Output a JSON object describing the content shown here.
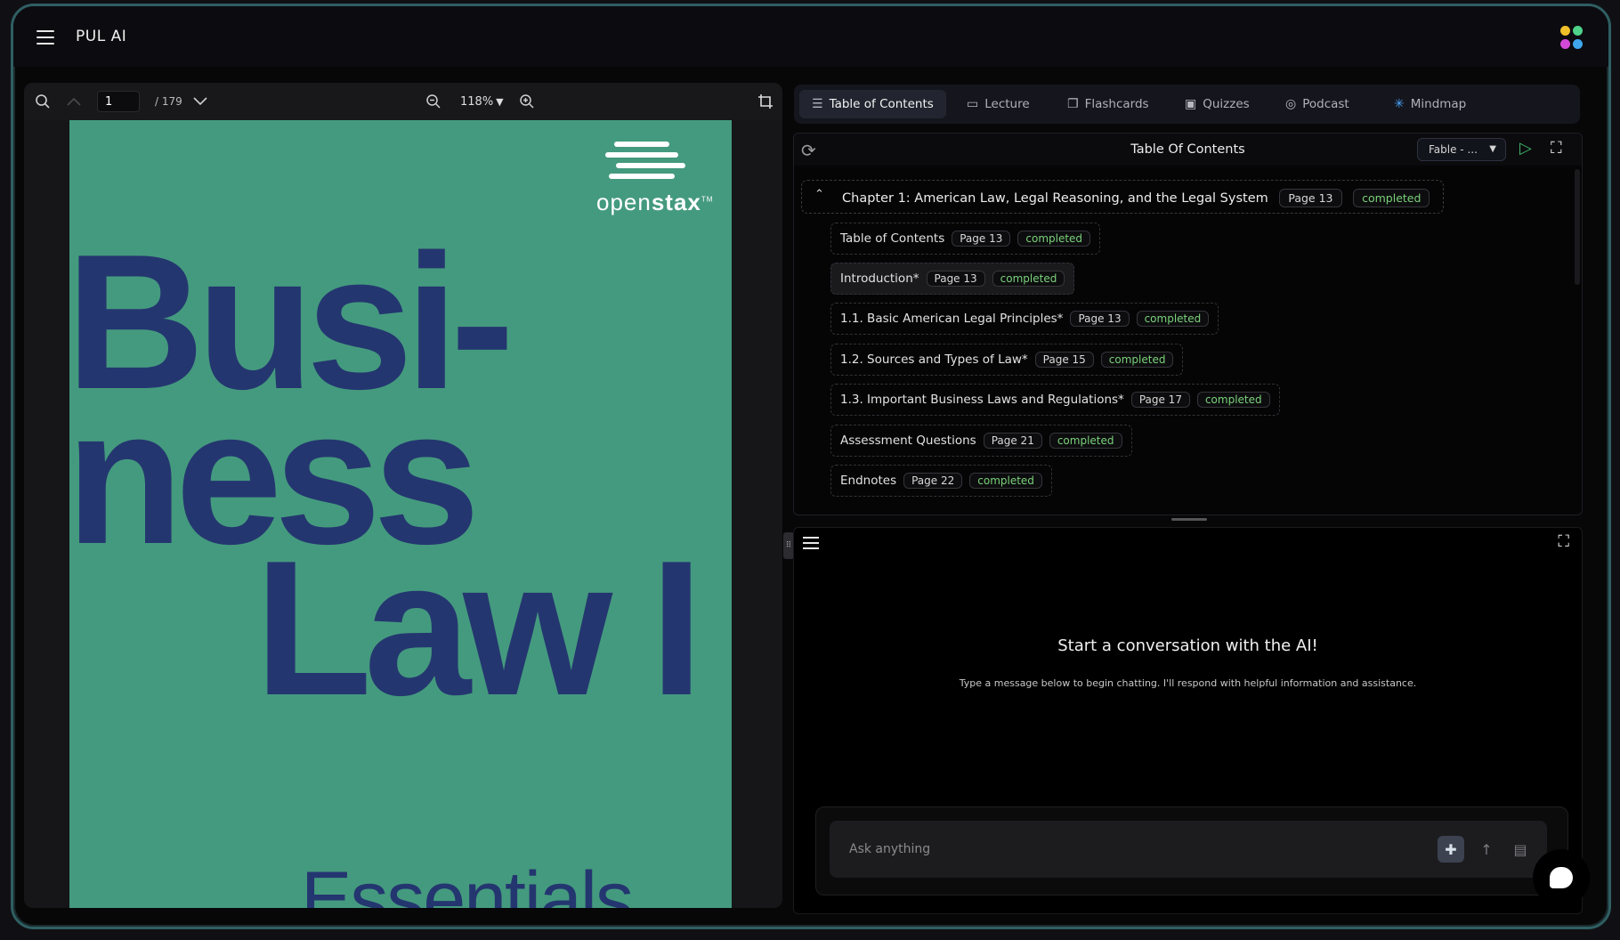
{
  "app": {
    "title": "PUL AI"
  },
  "colors": {
    "accent": "#449a7e",
    "cover_title": "#243670",
    "completed": "#7ad27a",
    "play": "#3fb56a",
    "frame": "#2f5f63"
  },
  "pdf_toolbar": {
    "page_value": "1",
    "page_total": "/ 179",
    "zoom": "118%",
    "icons": [
      "search-icon",
      "chevron-up-icon",
      "chevron-down-icon",
      "zoom-out-icon",
      "zoom-in-icon",
      "crop-icon"
    ]
  },
  "cover": {
    "logo_text_light": "open",
    "logo_text_bold": "stax",
    "logo_tm": "TM",
    "line1": "Busi-",
    "line2": "ness",
    "line3": "Law I",
    "line4": "Essentials"
  },
  "tabs": [
    {
      "label": "Table of Contents",
      "icon": "list-icon"
    },
    {
      "label": "Lecture",
      "icon": "presentation-icon"
    },
    {
      "label": "Flashcards",
      "icon": "cards-icon"
    },
    {
      "label": "Quizzes",
      "icon": "quiz-icon"
    },
    {
      "label": "Podcast",
      "icon": "podcast-icon"
    },
    {
      "label": "Mindmap",
      "icon": "mindmap-icon"
    }
  ],
  "toc": {
    "title": "Table Of Contents",
    "voice_select": "Fable - ...",
    "chapter": {
      "label": "Chapter 1: American Law, Legal Reasoning, and the Legal System",
      "page": "Page 13",
      "status": "completed"
    },
    "items": [
      {
        "label": "Table of Contents",
        "page": "Page 13",
        "status": "completed"
      },
      {
        "label": "Introduction*",
        "page": "Page 13",
        "status": "completed"
      },
      {
        "label": "1.1. Basic American Legal Principles*",
        "page": "Page 13",
        "status": "completed"
      },
      {
        "label": "1.2. Sources and Types of Law*",
        "page": "Page 15",
        "status": "completed"
      },
      {
        "label": "1.3. Important Business Laws and Regulations*",
        "page": "Page 17",
        "status": "completed"
      },
      {
        "label": "Assessment Questions",
        "page": "Page 21",
        "status": "completed"
      },
      {
        "label": "Endnotes",
        "page": "Page 22",
        "status": "completed"
      }
    ]
  },
  "chat": {
    "heading": "Start a conversation with the AI!",
    "subtext": "Type a message below to begin chatting. I'll respond with helpful information and assistance.",
    "placeholder": "Ask anything"
  }
}
